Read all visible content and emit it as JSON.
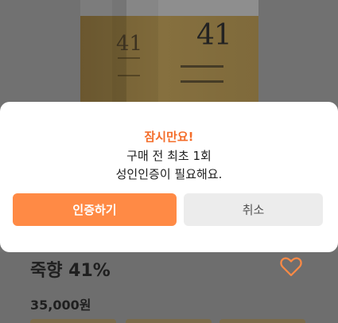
{
  "dialog": {
    "title": "잠시만요!",
    "line1": "구매 전 최초 1회",
    "line2": "성인인증이 필요해요.",
    "confirm_label": "인증하기",
    "cancel_label": "취소"
  },
  "product": {
    "name": "죽향 41%",
    "price": "35,000원",
    "bottle_label": "41",
    "box_label": "41"
  },
  "colors": {
    "accent": "#ff8a45",
    "title": "#f46d2a"
  }
}
